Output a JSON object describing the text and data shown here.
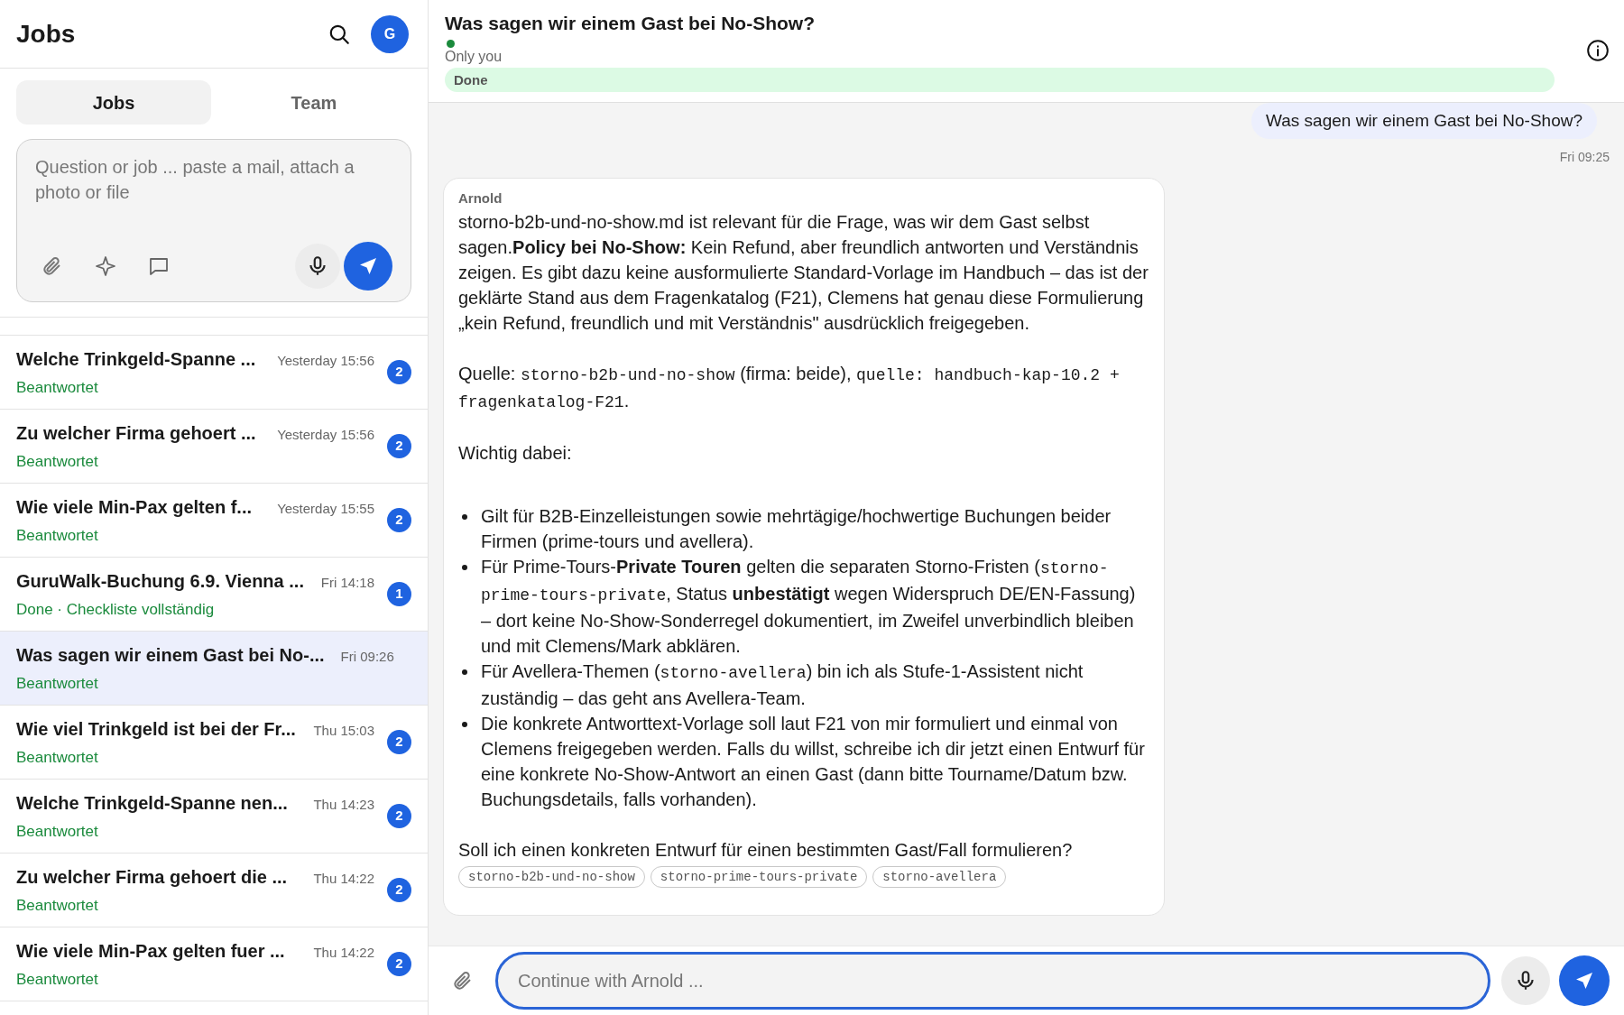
{
  "sidebar": {
    "title": "Jobs",
    "avatar": "G",
    "tabs": [
      {
        "label": "Jobs",
        "selected": true
      },
      {
        "label": "Team",
        "selected": false
      }
    ],
    "composer": {
      "placeholder": "Question or job ... paste a mail, attach a photo or file"
    },
    "jobs": [
      {
        "title": "Welche Trinkgeld-Spanne ...",
        "time": "Yesterday 15:56",
        "status": "Beantwortet",
        "badge": "2",
        "selected": false
      },
      {
        "title": "Zu welcher Firma gehoert ...",
        "time": "Yesterday 15:56",
        "status": "Beantwortet",
        "badge": "2",
        "selected": false
      },
      {
        "title": "Wie viele Min-Pax gelten f...",
        "time": "Yesterday 15:55",
        "status": "Beantwortet",
        "badge": "2",
        "selected": false
      },
      {
        "title": "GuruWalk-Buchung 6.9. Vienna ...",
        "time": "Fri 14:18",
        "status": "Done · Checkliste vollständig",
        "badge": "1",
        "selected": false
      },
      {
        "title": "Was sagen wir einem Gast bei No-...",
        "time": "Fri 09:26",
        "status": "Beantwortet",
        "selected": true
      },
      {
        "title": "Wie viel Trinkgeld ist bei der Fr...",
        "time": "Thu 15:03",
        "status": "Beantwortet",
        "badge": "2",
        "selected": false
      },
      {
        "title": "Welche Trinkgeld-Spanne nen...",
        "time": "Thu 14:23",
        "status": "Beantwortet",
        "badge": "2",
        "selected": false
      },
      {
        "title": "Zu welcher Firma gehoert die ...",
        "time": "Thu 14:22",
        "status": "Beantwortet",
        "badge": "2",
        "selected": false
      },
      {
        "title": "Wie viele Min-Pax gelten fuer ...",
        "time": "Thu 14:22",
        "status": "Beantwortet",
        "badge": "2",
        "selected": false
      }
    ]
  },
  "conversation": {
    "title": "Was sagen wir einem Gast bei No-Show?",
    "visibility": "Only you",
    "status": "Done",
    "user_message": {
      "text": "Was sagen wir einem Gast bei No-Show?",
      "time": "Fri 09:25"
    },
    "reply": {
      "author": "Arnold",
      "blocks": [
        {
          "kind": "paragraph",
          "segments": [
            {
              "kind": "plain",
              "text": "storno-b2b-und-no-show.md ist relevant für die Frage, was wir dem Gast selbst sagen."
            },
            {
              "kind": "bold",
              "text": "Policy bei No-Show:"
            },
            {
              "kind": "plain",
              "text": " Kein Refund, aber freundlich antworten und Verständnis zeigen. Es gibt dazu keine ausformulierte Standard-Vorlage im Handbuch – das ist der geklärte Stand aus dem Fragenkatalog (F21), Clemens hat genau diese Formulierung „kein Refund, freundlich und mit Verständnis\" ausdrücklich freigegeben."
            }
          ]
        },
        {
          "kind": "paragraph",
          "segments": [
            {
              "kind": "plain",
              "text": "Quelle: "
            },
            {
              "kind": "code",
              "text": "storno-b2b-und-no-show"
            },
            {
              "kind": "plain",
              "text": " (firma: beide), "
            },
            {
              "kind": "code",
              "text": "quelle: handbuch-kap-10.2 + fragenkatalog-F21"
            },
            {
              "kind": "plain",
              "text": "."
            }
          ]
        },
        {
          "kind": "paragraph",
          "segments": [
            {
              "kind": "plain",
              "text": "Wichtig dabei:"
            }
          ]
        },
        {
          "kind": "bullets",
          "items": [
            [
              {
                "kind": "plain",
                "text": "Gilt für B2B-Einzelleistungen sowie mehrtägige/hochwertige Buchungen beider Firmen (prime-tours und avellera)."
              }
            ],
            [
              {
                "kind": "plain",
                "text": "Für Prime-Tours-"
              },
              {
                "kind": "bold",
                "text": "Private Touren"
              },
              {
                "kind": "plain",
                "text": " gelten die separaten Storno-Fristen ("
              },
              {
                "kind": "code",
                "text": "storno-prime-tours-private"
              },
              {
                "kind": "plain",
                "text": ", Status "
              },
              {
                "kind": "bold",
                "text": "unbestätigt"
              },
              {
                "kind": "plain",
                "text": " wegen Widerspruch DE/EN-Fassung) – dort keine No-Show-Sonderregel dokumentiert, im Zweifel unverbindlich bleiben und mit Clemens/Mark abklären."
              }
            ],
            [
              {
                "kind": "plain",
                "text": "Für Avellera-Themen ("
              },
              {
                "kind": "code",
                "text": "storno-avellera"
              },
              {
                "kind": "plain",
                "text": ") bin ich als Stufe-1-Assistent nicht zuständig – das geht ans Avellera-Team."
              }
            ],
            [
              {
                "kind": "plain",
                "text": "Die konkrete Antworttext-Vorlage soll laut F21 von mir formuliert und einmal von Clemens freigegeben werden. Falls du willst, schreibe ich dir jetzt einen Entwurf für eine konkrete No-Show-Antwort an einen Gast (dann bitte Tourname/Datum bzw. Buchungsdetails, falls vorhanden)."
              }
            ]
          ]
        },
        {
          "kind": "paragraph",
          "segments": [
            {
              "kind": "plain",
              "text": "Soll ich einen konkreten Entwurf für einen bestimmten Gast/Fall formulieren?"
            }
          ]
        }
      ],
      "tags": [
        "storno-b2b-und-no-show",
        "storno-prime-tours-private",
        "storno-avellera"
      ]
    },
    "input": {
      "placeholder": "Continue with Arnold ..."
    }
  }
}
